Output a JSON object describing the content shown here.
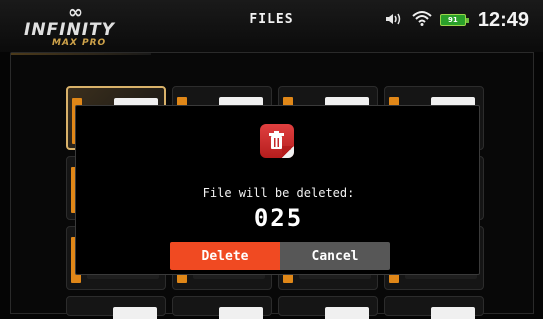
{
  "header": {
    "logo": {
      "symbol": "∞",
      "name": "INFINITY",
      "sub": "MAX PRO"
    },
    "title": "FILES"
  },
  "status": {
    "battery": "91",
    "time": "12:49"
  },
  "dialog": {
    "message": "File will be deleted:",
    "file_name": "025",
    "delete_label": "Delete",
    "cancel_label": "Cancel"
  },
  "colors": {
    "accent_orange": "#f04a22",
    "cancel_gray": "#575757",
    "battery_green": "#2aa02a",
    "tile_orange": "#e08718",
    "selection_gold": "#d9b26a"
  },
  "icons": [
    "volume-icon",
    "wifi-icon",
    "battery-icon",
    "trash-icon"
  ]
}
